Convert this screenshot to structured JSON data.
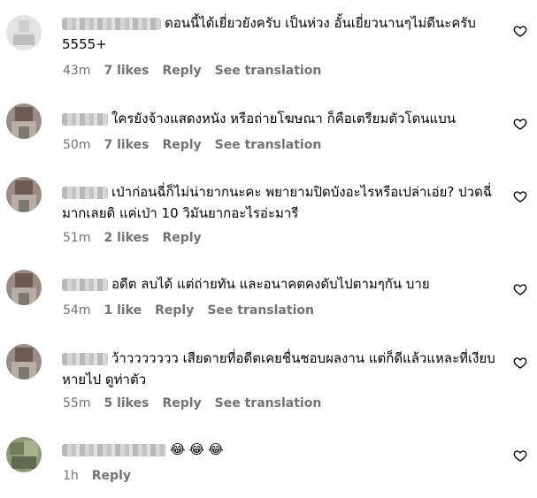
{
  "comments": [
    {
      "text": "ดอนนี้ได้เยี่ยวยังครับ เป็นห่วง อั้นเยี่ยวนานๆไม่ดีนะครับ 5555+",
      "time": "43m",
      "likes": "7 likes",
      "reply": "Reply",
      "translate": "See translation"
    },
    {
      "text": "ใครยังจ้างแสดงหนัง หรือถ่ายโฆษณา ก็คือเตรียมตัวโดนแบน",
      "time": "50m",
      "likes": "7 likes",
      "reply": "Reply",
      "translate": "See translation"
    },
    {
      "text": "เป่าก่อนฉี่ก็ไม่น่ายากนะคะ พยายามปิดบังอะไรหรือเปล่าเอ่ย? ปวดฉี่มากเลยดิ แค่เป่า 10 วิมันยากอะไรอ่ะมารี",
      "time": "51m",
      "likes": "2 likes",
      "reply": "Reply"
    },
    {
      "text": "อดีต ลบได้ แต่ถ่ายทัน และอนาคตคงดับไปตามๆกัน บาย",
      "time": "54m",
      "likes": "1 like",
      "reply": "Reply",
      "translate": "See translation"
    },
    {
      "text": "ว้าววววววว เสียดายที่อดีตเคยชื่นชอบผลงาน แต่ก็ดีแล้วแหละที่เงียบหายไป ดูท่าตัว",
      "time": "55m",
      "likes": "5 likes",
      "reply": "Reply",
      "translate": "See translation"
    },
    {
      "emojis": [
        "😂",
        "😂",
        "😂"
      ],
      "time": "1h",
      "reply": "Reply"
    }
  ],
  "colors": {
    "meta_text": "#737373",
    "text": "#000000"
  },
  "icons": {
    "like": "heart-outline-icon"
  }
}
